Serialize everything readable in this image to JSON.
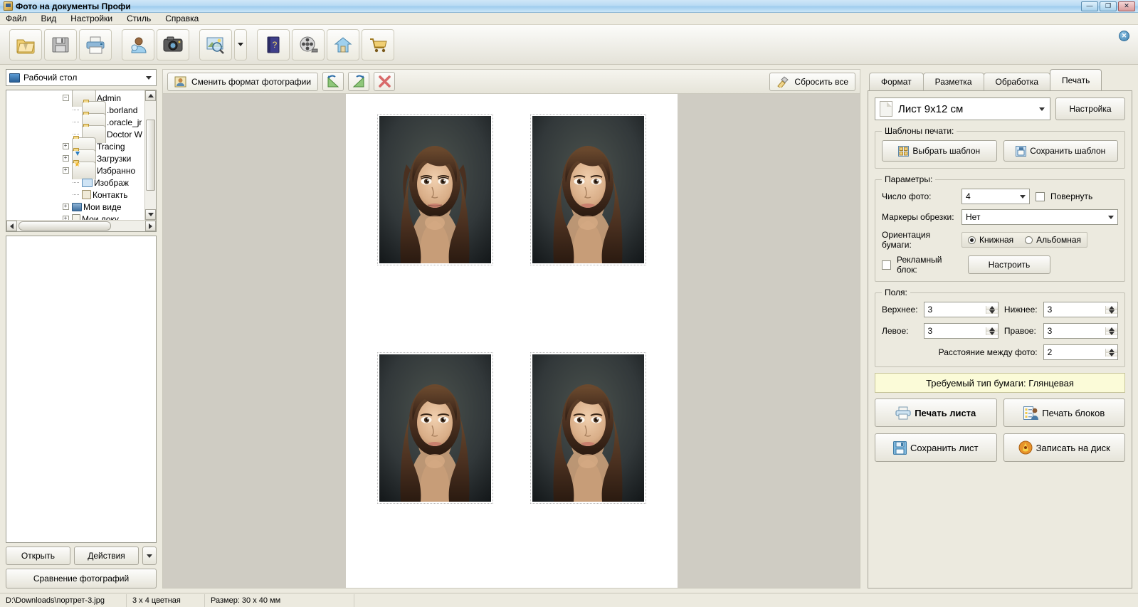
{
  "window": {
    "title": "Фото на документы Профи",
    "title_icon": "app-icon",
    "minimize": "—",
    "maximize": "❐",
    "close": "✕"
  },
  "menu": {
    "items": [
      {
        "label": "Файл"
      },
      {
        "label": "Вид"
      },
      {
        "label": "Настройки"
      },
      {
        "label": "Стиль"
      },
      {
        "label": "Справка"
      }
    ]
  },
  "toolbar": {
    "buttons": [
      {
        "name": "open-folder-icon",
        "tooltip": "Открыть"
      },
      {
        "name": "save-icon",
        "tooltip": "Сохранить"
      },
      {
        "name": "print-icon",
        "tooltip": "Печать"
      },
      {
        "name": "person-icon",
        "tooltip": "Фото на документы"
      },
      {
        "name": "camera-icon",
        "tooltip": "Снимок с камеры"
      },
      {
        "name": "preview-search-icon",
        "tooltip": "Просмотр"
      },
      {
        "name": "help-book-icon",
        "tooltip": "Справка"
      },
      {
        "name": "film-reel-icon",
        "tooltip": "Видеоурок"
      },
      {
        "name": "home-icon",
        "tooltip": "Домашняя страница"
      },
      {
        "name": "cart-icon",
        "tooltip": "Купить"
      }
    ],
    "close_badge": "✕"
  },
  "left_panel": {
    "drive": {
      "label": "Рабочий стол",
      "icon": "monitor-icon"
    },
    "tree": [
      {
        "label": "Admin",
        "indent": 1,
        "toggle": "-",
        "icon": "folder"
      },
      {
        "label": ".borland",
        "indent": 2,
        "toggle": "",
        "icon": "folder"
      },
      {
        "label": ".oracle_jr",
        "indent": 2,
        "toggle": "",
        "icon": "folder"
      },
      {
        "label": "Doctor W",
        "indent": 2,
        "toggle": "",
        "icon": "folder"
      },
      {
        "label": "Tracing",
        "indent": 2,
        "toggle": "+",
        "icon": "folder"
      },
      {
        "label": "Загрузки",
        "indent": 2,
        "toggle": "+",
        "icon": "folder-download"
      },
      {
        "label": "Избранно",
        "indent": 2,
        "toggle": "+",
        "icon": "folder-fav"
      },
      {
        "label": "Изображ",
        "indent": 2,
        "toggle": "",
        "icon": "pictures"
      },
      {
        "label": "Контакть",
        "indent": 2,
        "toggle": "",
        "icon": "contacts"
      },
      {
        "label": "Мои виде",
        "indent": 2,
        "toggle": "+",
        "icon": "video"
      },
      {
        "label": "Мои доку",
        "indent": 2,
        "toggle": "+",
        "icon": "documents"
      }
    ],
    "buttons": {
      "open": "Открыть",
      "actions": "Действия",
      "compare": "Сравнение фотографий"
    }
  },
  "center": {
    "change_format_button": "Сменить формат фотографии",
    "rotate_left": "rotate-left-icon",
    "rotate_right": "rotate-right-icon",
    "delete": "delete-icon",
    "reset_all_button": "Сбросить все",
    "sheet": {
      "photos": [
        {
          "alt": "портрет"
        },
        {
          "alt": "портрет"
        },
        {
          "alt": "портрет"
        },
        {
          "alt": "портрет"
        }
      ]
    }
  },
  "right_panel": {
    "tabs": [
      {
        "label": "Формат",
        "active": false
      },
      {
        "label": "Разметка",
        "active": false
      },
      {
        "label": "Обработка",
        "active": false
      },
      {
        "label": "Печать",
        "active": true
      }
    ],
    "sheet_size": {
      "value": "Лист 9x12 см",
      "settings_button": "Настройка"
    },
    "templates": {
      "legend": "Шаблоны печати:",
      "select": "Выбрать шаблон",
      "save": "Сохранить шаблон"
    },
    "parameters": {
      "legend": "Параметры:",
      "photo_count_label": "Число фото:",
      "photo_count_value": "4",
      "rotate_label": "Повернуть",
      "rotate_checked": false,
      "crop_markers_label": "Маркеры обрезки:",
      "crop_markers_value": "Нет",
      "orientation_label": "Ориентация бумаги:",
      "orientation_portrait": "Книжная",
      "orientation_landscape": "Альбомная",
      "orientation_selected": "Книжная",
      "ad_block_label": "Рекламный блок:",
      "ad_block_checked": false,
      "ad_block_button": "Настроить"
    },
    "margins": {
      "legend": "Поля:",
      "top_label": "Верхнее:",
      "top_value": "3",
      "bottom_label": "Нижнее:",
      "bottom_value": "3",
      "left_label": "Левое:",
      "left_value": "3",
      "right_label": "Правое:",
      "right_value": "3",
      "spacing_label": "Расстояние между фото:",
      "spacing_value": "2"
    },
    "paper_banner": "Требуемый тип бумаги: Глянцевая",
    "actions": {
      "print_sheet": "Печать листа",
      "print_blocks": "Печать блоков",
      "save_sheet": "Сохранить лист",
      "burn_disc": "Записать на диск"
    }
  },
  "statusbar": {
    "file_path": "D:\\Downloads\\портрет-3.jpg",
    "format": "3 x 4 цветная",
    "size": "Размер: 30 x 40 мм"
  },
  "colors": {
    "title_bar": "#9fcdee",
    "panel_bg": "#eceadf",
    "canvas_bg": "#cfccc3",
    "banner_bg": "#fbfbd8",
    "accent": "#3d7fae"
  }
}
